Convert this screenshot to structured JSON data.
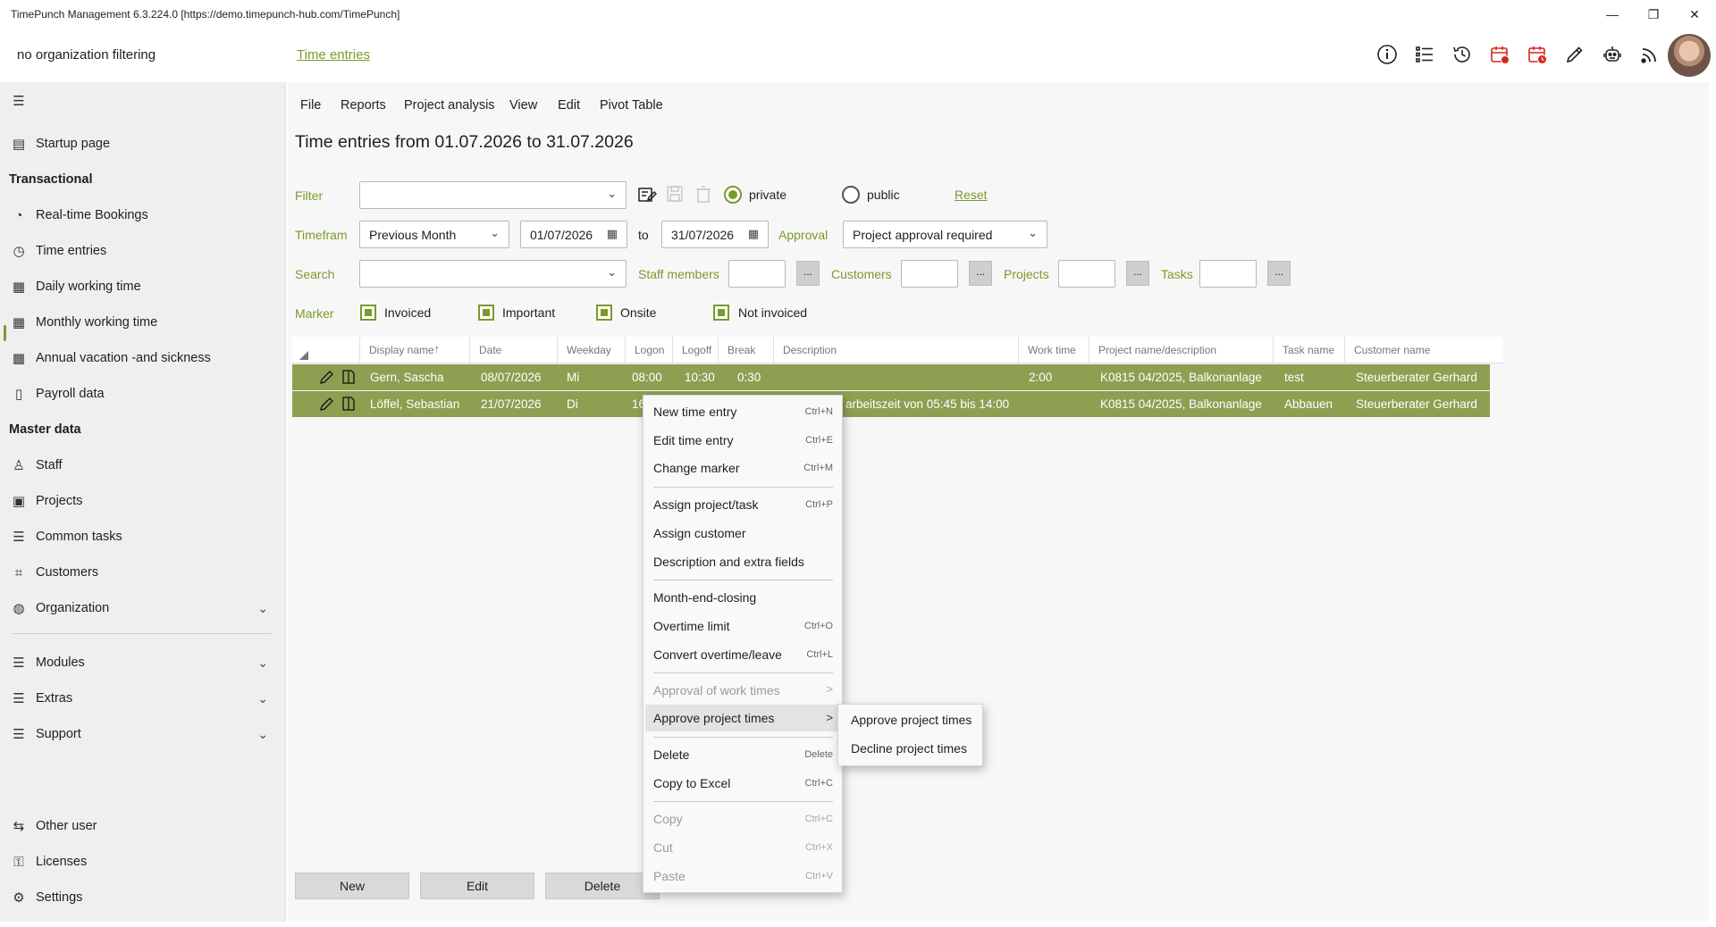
{
  "window": {
    "title": "TimePunch Management 6.3.224.0 [https://demo.timepunch-hub.com/TimePunch]",
    "minimize": "—",
    "restore": "❐",
    "close": "✕"
  },
  "header": {
    "org_filter": "no organization filtering",
    "breadcrumb": "Time entries",
    "icons": [
      "info-icon",
      "list-icon",
      "history-icon",
      "calendar-warning-icon",
      "calendar-clock-icon",
      "pencil-icon",
      "robot-icon",
      "feed-icon"
    ]
  },
  "sidebar": {
    "sections": {
      "transactional": "Transactional",
      "master": "Master data"
    },
    "items": [
      {
        "label": "Startup page",
        "icon": "startup-icon"
      },
      {
        "label": "Real-time Bookings",
        "icon": "stopwatch-icon"
      },
      {
        "label": "Time entries",
        "icon": "clock-icon"
      },
      {
        "label": "Daily working time",
        "icon": "calendar-icon"
      },
      {
        "label": "Monthly working time",
        "icon": "calendar-30-icon"
      },
      {
        "label": "Annual vacation -and sickness",
        "icon": "calendar-365-icon"
      },
      {
        "label": "Payroll data",
        "icon": "payroll-icon"
      },
      {
        "label": "Staff",
        "icon": "person-icon"
      },
      {
        "label": "Projects",
        "icon": "projects-icon"
      },
      {
        "label": "Common tasks",
        "icon": "tasks-icon"
      },
      {
        "label": "Customers",
        "icon": "customers-icon"
      },
      {
        "label": "Organization",
        "icon": "globe-icon"
      },
      {
        "label": "Modules",
        "icon": "modules-icon"
      },
      {
        "label": "Extras",
        "icon": "extras-icon"
      },
      {
        "label": "Support",
        "icon": "support-icon"
      },
      {
        "label": "Other user",
        "icon": "other-user-icon"
      },
      {
        "label": "Licenses",
        "icon": "licenses-icon"
      },
      {
        "label": "Settings",
        "icon": "gear-icon"
      }
    ]
  },
  "menu": [
    "File",
    "Reports",
    "Project analysis",
    "View",
    "Edit",
    "Pivot Table"
  ],
  "page_title": "Time entries from 01.07.2026 to 31.07.2026",
  "filters": {
    "filter_label": "Filter",
    "filter_value": "",
    "private_label": "private",
    "public_label": "public",
    "reset_label": "Reset",
    "timeframe_label": "Timefram",
    "timeframe_value": "Previous Month",
    "date_from": "01/07/2026",
    "to_label": "to",
    "date_to": "31/07/2026",
    "approval_label": "Approval",
    "approval_value": "Project approval required",
    "search_label": "Search",
    "staff_label": "Staff members",
    "customers_label": "Customers",
    "projects_label": "Projects",
    "tasks_label": "Tasks",
    "ellipsis": "...",
    "marker_label": "Marker",
    "markers": [
      "Invoiced",
      "Important",
      "Onsite",
      "Not invoiced"
    ]
  },
  "grid": {
    "columns": [
      "Display name",
      "Date",
      "Weekday",
      "Logon",
      "Logoff",
      "Break",
      "Description",
      "Work time",
      "Project name/description",
      "Task name",
      "Customer name"
    ],
    "rows": [
      {
        "name": "Gern, Sascha",
        "date": "08/07/2026",
        "weekday": "Mi",
        "logon": "08:00",
        "logoff": "10:30",
        "break": "0:30",
        "description": "",
        "work_time": "2:00",
        "project": "K0815 04/2025, Balkonanlage",
        "task": "test",
        "customer": "Steuerberater Gerhard"
      },
      {
        "name": "Löffel, Sebastian",
        "date": "21/07/2026",
        "weekday": "Di",
        "logon": "16",
        "logoff": "",
        "break": "",
        "description": "arbeitszeit von 05:45 bis 14:00",
        "work_time": "",
        "project": "K0815 04/2025, Balkonanlage",
        "task": "Abbauen",
        "customer": "Steuerberater Gerhard"
      }
    ]
  },
  "buttons": {
    "new": "New",
    "edit": "Edit",
    "delete": "Delete"
  },
  "context_menu": {
    "new_time_entry": {
      "label": "New time entry",
      "shortcut": "Ctrl+N"
    },
    "edit_time_entry": {
      "label": "Edit time entry",
      "shortcut": "Ctrl+E"
    },
    "change_marker": {
      "label": "Change marker",
      "shortcut": "Ctrl+M"
    },
    "assign_project": {
      "label": "Assign project/task",
      "shortcut": "Ctrl+P"
    },
    "assign_customer": {
      "label": "Assign customer"
    },
    "description_fields": {
      "label": "Description and extra fields"
    },
    "month_end": {
      "label": "Month-end-closing"
    },
    "overtime_limit": {
      "label": "Overtime limit",
      "shortcut": "Ctrl+O"
    },
    "convert_overtime": {
      "label": "Convert overtime/leave",
      "shortcut": "Ctrl+L"
    },
    "approval_work_times": {
      "label": "Approval of work times",
      "arrow": ">"
    },
    "approve_project_times": {
      "label": "Approve project times",
      "arrow": ">"
    },
    "delete": {
      "label": "Delete",
      "shortcut": "Delete"
    },
    "copy_excel": {
      "label": "Copy to Excel",
      "shortcut": "Ctrl+C"
    },
    "copy": {
      "label": "Copy",
      "shortcut": "Ctrl+C"
    },
    "cut": {
      "label": "Cut",
      "shortcut": "Ctrl+X"
    },
    "paste": {
      "label": "Paste",
      "shortcut": "Ctrl+V"
    }
  },
  "submenu": {
    "approve": "Approve project times",
    "decline": "Decline project times"
  },
  "colors": {
    "accent": "#7a9a2c",
    "row_selected": "#8e9f52",
    "alert_red": "#d9261c"
  }
}
